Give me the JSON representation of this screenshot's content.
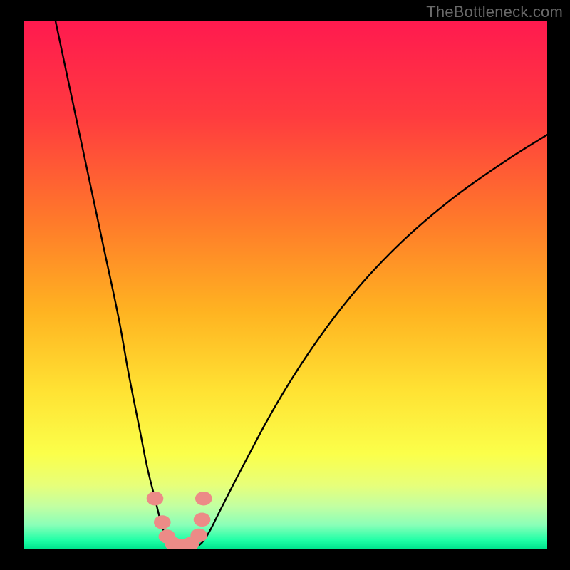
{
  "watermark": "TheBottleneck.com",
  "chart_data": {
    "type": "line",
    "title": "",
    "xlabel": "",
    "ylabel": "",
    "xlim": [
      0,
      100
    ],
    "ylim": [
      0,
      100
    ],
    "grid": false,
    "legend": false,
    "background_gradient": {
      "stops": [
        {
          "offset": 0.0,
          "color": "#ff1a4f"
        },
        {
          "offset": 0.18,
          "color": "#ff3b3f"
        },
        {
          "offset": 0.38,
          "color": "#ff7a2a"
        },
        {
          "offset": 0.55,
          "color": "#ffb321"
        },
        {
          "offset": 0.7,
          "color": "#ffe233"
        },
        {
          "offset": 0.82,
          "color": "#fbff4a"
        },
        {
          "offset": 0.88,
          "color": "#e7ff7a"
        },
        {
          "offset": 0.92,
          "color": "#c2ffa2"
        },
        {
          "offset": 0.955,
          "color": "#8affb8"
        },
        {
          "offset": 0.985,
          "color": "#1dffa6"
        },
        {
          "offset": 1.0,
          "color": "#00e58e"
        }
      ]
    },
    "series": [
      {
        "name": "left-branch",
        "x": [
          6,
          9,
          12,
          15,
          18,
          20,
          22,
          23.5,
          25,
          26,
          26.8,
          27.5,
          27.8
        ],
        "y": [
          100,
          86,
          72,
          58,
          44,
          33,
          23,
          15.5,
          9.5,
          5.5,
          2.9,
          1.1,
          0.6
        ]
      },
      {
        "name": "right-branch",
        "x": [
          33.5,
          34.2,
          35.5,
          38,
          42,
          48,
          55,
          63,
          72,
          82,
          92,
          100
        ],
        "y": [
          0.7,
          1.4,
          3.4,
          8.3,
          16.0,
          27.0,
          38.0,
          48.5,
          58.0,
          66.5,
          73.5,
          78.5
        ]
      },
      {
        "name": "valley-floor",
        "x": [
          27.8,
          28.6,
          29.6,
          30.6,
          31.6,
          32.6,
          33.5
        ],
        "y": [
          0.6,
          0.25,
          0.12,
          0.08,
          0.12,
          0.3,
          0.7
        ]
      }
    ],
    "markers": {
      "name": "highlight-dots",
      "color": "#ec8b87",
      "radius_pct": 1.4,
      "points": [
        {
          "x": 25.0,
          "y": 9.5
        },
        {
          "x": 26.4,
          "y": 5.0
        },
        {
          "x": 27.3,
          "y": 2.3
        },
        {
          "x": 28.5,
          "y": 0.9
        },
        {
          "x": 30.0,
          "y": 0.5
        },
        {
          "x": 31.8,
          "y": 0.9
        },
        {
          "x": 33.4,
          "y": 2.5
        },
        {
          "x": 34.0,
          "y": 5.5
        },
        {
          "x": 34.3,
          "y": 9.5
        }
      ]
    }
  }
}
